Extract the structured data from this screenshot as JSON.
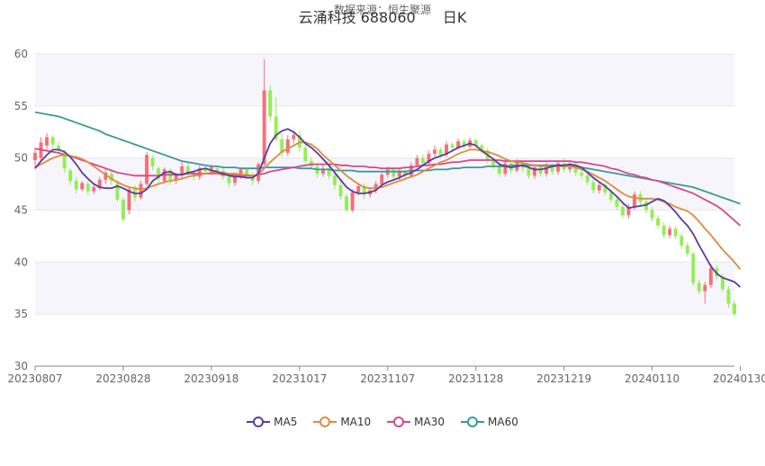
{
  "chart_data": {
    "type": "candlestick",
    "title": "云涌科技 688060",
    "title_suffix": "日K",
    "subtitle": "数据来源：恒生聚源",
    "ylim": [
      30,
      60
    ],
    "yticks": [
      30,
      35,
      40,
      45,
      50,
      55,
      60
    ],
    "xtick_labels": [
      "20230807",
      "20230828",
      "20230918",
      "20231017",
      "20231107",
      "20231128",
      "20231219",
      "20240110",
      "20240130"
    ],
    "xtick_index": [
      0,
      15,
      30,
      45,
      60,
      75,
      90,
      105,
      120
    ],
    "grid": "horizontal",
    "legend_position": "bottom",
    "colors": {
      "up": "#f56f79",
      "down": "#94ee54",
      "band": "#f5f5fb",
      "grid": "#e6e6ee",
      "axis": "#888888"
    },
    "candles": [
      [
        49.8,
        50.5,
        49.0,
        51.0
      ],
      [
        50.0,
        51.5,
        49.6,
        52.0
      ],
      [
        51.2,
        52.0,
        50.6,
        52.4
      ],
      [
        52.0,
        51.3,
        51.0,
        52.2
      ],
      [
        51.2,
        50.8,
        50.4,
        51.6
      ],
      [
        50.6,
        49.0,
        48.6,
        50.8
      ],
      [
        48.8,
        47.8,
        47.4,
        49.0
      ],
      [
        47.8,
        47.0,
        46.6,
        48.2
      ],
      [
        47.0,
        47.6,
        46.8,
        47.8
      ],
      [
        47.5,
        46.8,
        46.4,
        47.8
      ],
      [
        46.8,
        47.2,
        46.5,
        47.4
      ],
      [
        47.1,
        47.9,
        46.9,
        48.2
      ],
      [
        47.9,
        48.6,
        47.5,
        48.9
      ],
      [
        48.5,
        47.8,
        47.4,
        49.0
      ],
      [
        47.6,
        46.0,
        45.8,
        47.8
      ],
      [
        46.0,
        44.1,
        43.9,
        46.2
      ],
      [
        45.0,
        47.0,
        44.6,
        47.3
      ],
      [
        47.0,
        46.2,
        45.8,
        47.4
      ],
      [
        46.2,
        47.5,
        46.0,
        47.8
      ],
      [
        47.5,
        50.3,
        47.3,
        50.6
      ],
      [
        50.0,
        49.2,
        48.8,
        50.3
      ],
      [
        49.0,
        48.0,
        47.6,
        49.2
      ],
      [
        47.8,
        48.9,
        47.5,
        49.1
      ],
      [
        48.8,
        47.9,
        47.4,
        49.0
      ],
      [
        47.9,
        48.4,
        47.5,
        48.6
      ],
      [
        48.4,
        49.2,
        48.0,
        49.6
      ],
      [
        49.2,
        48.6,
        48.3,
        49.5
      ],
      [
        48.6,
        48.2,
        47.9,
        48.8
      ],
      [
        48.2,
        49.0,
        47.9,
        49.3
      ],
      [
        49.0,
        48.7,
        48.4,
        49.3
      ],
      [
        48.7,
        49.1,
        48.4,
        49.4
      ],
      [
        49.0,
        48.8,
        48.5,
        49.2
      ],
      [
        48.8,
        48.2,
        47.9,
        49.0
      ],
      [
        48.2,
        47.6,
        47.2,
        48.4
      ],
      [
        47.6,
        48.3,
        47.3,
        48.5
      ],
      [
        48.3,
        48.9,
        48.0,
        49.1
      ],
      [
        48.9,
        48.4,
        48.1,
        49.0
      ],
      [
        48.4,
        47.8,
        47.4,
        48.6
      ],
      [
        47.8,
        49.4,
        47.5,
        49.6
      ],
      [
        49.4,
        56.5,
        49.2,
        59.5
      ],
      [
        56.5,
        54.0,
        53.5,
        57.0
      ],
      [
        54.0,
        51.8,
        51.6,
        55.8
      ],
      [
        51.8,
        50.5,
        50.1,
        52.4
      ],
      [
        50.5,
        51.8,
        50.2,
        52.2
      ],
      [
        51.8,
        52.2,
        51.4,
        52.6
      ],
      [
        52.2,
        51.0,
        50.6,
        52.6
      ],
      [
        51.0,
        49.7,
        49.4,
        51.4
      ],
      [
        49.7,
        49.2,
        48.9,
        50.1
      ],
      [
        49.2,
        48.5,
        48.1,
        49.5
      ],
      [
        48.5,
        49.0,
        48.2,
        49.4
      ],
      [
        49.0,
        48.3,
        48.0,
        49.3
      ],
      [
        48.3,
        47.4,
        47.0,
        48.5
      ],
      [
        47.4,
        46.3,
        46.0,
        47.8
      ],
      [
        46.3,
        45.0,
        44.8,
        46.5
      ],
      [
        45.0,
        46.7,
        44.8,
        47.0
      ],
      [
        46.7,
        47.3,
        46.4,
        47.6
      ],
      [
        47.3,
        46.5,
        46.1,
        47.6
      ],
      [
        46.5,
        46.9,
        46.2,
        47.1
      ],
      [
        46.9,
        47.5,
        46.6,
        47.8
      ],
      [
        47.5,
        48.4,
        47.2,
        48.6
      ],
      [
        48.4,
        48.9,
        48.1,
        49.2
      ],
      [
        48.9,
        48.2,
        47.9,
        49.1
      ],
      [
        48.2,
        48.8,
        47.9,
        49.1
      ],
      [
        48.8,
        48.3,
        48.0,
        49.0
      ],
      [
        48.3,
        49.3,
        48.1,
        49.6
      ],
      [
        49.3,
        50.0,
        49.1,
        50.3
      ],
      [
        50.0,
        49.5,
        49.2,
        50.3
      ],
      [
        49.5,
        50.4,
        49.3,
        50.7
      ],
      [
        50.4,
        50.8,
        50.1,
        51.2
      ],
      [
        50.8,
        50.3,
        50.0,
        51.0
      ],
      [
        50.3,
        51.3,
        50.1,
        51.6
      ],
      [
        51.3,
        51.0,
        50.7,
        51.5
      ],
      [
        51.0,
        51.6,
        50.8,
        51.9
      ],
      [
        51.6,
        51.1,
        50.8,
        51.8
      ],
      [
        51.1,
        51.7,
        50.9,
        52.0
      ],
      [
        51.7,
        51.2,
        50.9,
        51.9
      ],
      [
        51.2,
        50.7,
        50.4,
        51.4
      ],
      [
        50.7,
        49.8,
        49.5,
        51.0
      ],
      [
        49.8,
        49.3,
        48.9,
        50.0
      ],
      [
        49.3,
        48.5,
        48.2,
        49.6
      ],
      [
        48.5,
        49.5,
        48.2,
        49.8
      ],
      [
        49.5,
        48.8,
        48.5,
        49.7
      ],
      [
        48.8,
        49.6,
        48.6,
        49.9
      ],
      [
        49.6,
        49.0,
        48.7,
        49.8
      ],
      [
        49.0,
        48.3,
        48.0,
        49.3
      ],
      [
        48.3,
        49.1,
        48.0,
        49.4
      ],
      [
        49.1,
        48.5,
        48.2,
        49.3
      ],
      [
        48.5,
        49.3,
        48.2,
        49.6
      ],
      [
        49.3,
        48.7,
        48.4,
        49.5
      ],
      [
        48.7,
        49.5,
        48.4,
        49.8
      ],
      [
        49.5,
        48.9,
        48.6,
        50.0
      ],
      [
        48.9,
        49.4,
        48.6,
        49.7
      ],
      [
        49.4,
        48.6,
        48.3,
        49.6
      ],
      [
        48.6,
        48.3,
        48.0,
        48.8
      ],
      [
        48.3,
        47.7,
        47.4,
        48.5
      ],
      [
        47.7,
        46.9,
        46.6,
        48.0
      ],
      [
        46.9,
        47.4,
        46.6,
        47.7
      ],
      [
        47.4,
        46.7,
        46.4,
        47.6
      ],
      [
        46.7,
        46.0,
        45.7,
        47.0
      ],
      [
        46.0,
        45.3,
        45.0,
        46.3
      ],
      [
        45.3,
        44.5,
        44.2,
        45.6
      ],
      [
        44.5,
        45.3,
        44.2,
        45.6
      ],
      [
        45.3,
        46.5,
        45.0,
        46.8
      ],
      [
        46.5,
        45.8,
        45.4,
        46.8
      ],
      [
        45.8,
        45.0,
        44.7,
        46.1
      ],
      [
        45.0,
        44.2,
        43.9,
        45.3
      ],
      [
        44.2,
        43.5,
        43.2,
        44.5
      ],
      [
        43.5,
        42.6,
        42.3,
        43.8
      ],
      [
        42.6,
        43.2,
        42.3,
        43.5
      ],
      [
        43.2,
        42.5,
        42.2,
        43.5
      ],
      [
        42.5,
        41.6,
        41.3,
        42.8
      ],
      [
        41.6,
        40.8,
        40.5,
        41.9
      ],
      [
        40.8,
        38.0,
        37.7,
        41.0
      ],
      [
        38.0,
        37.2,
        36.9,
        38.3
      ],
      [
        37.2,
        37.8,
        36.0,
        38.1
      ],
      [
        37.8,
        39.4,
        37.5,
        39.8
      ],
      [
        39.4,
        38.6,
        38.3,
        39.7
      ],
      [
        38.6,
        37.4,
        37.1,
        38.9
      ],
      [
        37.4,
        36.0,
        35.6,
        37.7
      ],
      [
        36.0,
        35.0,
        34.8,
        36.3
      ]
    ],
    "series": [
      {
        "name": "MA5",
        "color": "#5a3d9c",
        "values": [
          49.0,
          49.7,
          50.3,
          50.8,
          50.8,
          50.6,
          50.1,
          49.4,
          48.6,
          48.0,
          47.5,
          47.2,
          47.1,
          47.1,
          47.3,
          47.1,
          46.8,
          46.6,
          46.6,
          47.0,
          47.8,
          48.2,
          48.6,
          48.7,
          48.4,
          48.4,
          48.6,
          48.7,
          48.9,
          49.0,
          48.8,
          48.7,
          48.5,
          48.3,
          48.2,
          48.2,
          48.1,
          48.1,
          48.5,
          50.0,
          51.4,
          52.2,
          52.6,
          52.8,
          52.5,
          52.0,
          51.4,
          51.0,
          50.5,
          49.9,
          49.3,
          48.6,
          47.9,
          47.2,
          46.8,
          46.6,
          46.6,
          46.7,
          46.9,
          47.4,
          47.7,
          47.9,
          48.1,
          48.4,
          48.6,
          48.9,
          49.3,
          49.7,
          50.0,
          50.2,
          50.4,
          50.7,
          51.0,
          51.2,
          51.4,
          51.2,
          50.7,
          50.3,
          49.9,
          49.4,
          49.2,
          49.1,
          49.2,
          49.3,
          49.1,
          48.9,
          48.9,
          49.0,
          49.2,
          49.3,
          49.3,
          49.4,
          49.3,
          49.1,
          48.6,
          48.1,
          47.7,
          47.3,
          46.8,
          46.3,
          45.7,
          45.2,
          45.3,
          45.4,
          45.5,
          45.8,
          46.1,
          45.9,
          45.4,
          44.8,
          44.1,
          43.5,
          42.7,
          41.6,
          40.6,
          39.6,
          38.9,
          38.5,
          38.3,
          38.1,
          37.6
        ]
      },
      {
        "name": "MA10",
        "color": "#e08a3c",
        "values": [
          49.1,
          49.4,
          49.7,
          50.0,
          50.2,
          50.3,
          50.2,
          50.1,
          49.9,
          49.6,
          49.2,
          48.8,
          48.4,
          48.0,
          47.7,
          47.4,
          47.2,
          47.1,
          47.0,
          47.1,
          47.3,
          47.5,
          47.7,
          47.8,
          47.9,
          48.0,
          48.2,
          48.3,
          48.4,
          48.5,
          48.6,
          48.6,
          48.6,
          48.5,
          48.5,
          48.4,
          48.4,
          48.3,
          48.4,
          49.0,
          49.6,
          50.1,
          50.6,
          50.9,
          51.2,
          51.5,
          51.5,
          51.3,
          50.9,
          50.3,
          49.8,
          49.3,
          48.8,
          48.3,
          47.9,
          47.5,
          47.2,
          47.1,
          47.1,
          47.2,
          47.4,
          47.6,
          47.8,
          48.0,
          48.2,
          48.4,
          48.7,
          49.0,
          49.3,
          49.6,
          49.8,
          50.1,
          50.4,
          50.6,
          50.8,
          50.8,
          50.7,
          50.6,
          50.4,
          50.2,
          49.9,
          49.7,
          49.6,
          49.5,
          49.4,
          49.3,
          49.2,
          49.2,
          49.2,
          49.2,
          49.2,
          49.2,
          49.1,
          48.9,
          48.7,
          48.4,
          48.1,
          47.8,
          47.4,
          47.0,
          46.6,
          46.3,
          46.2,
          46.1,
          46.1,
          46.1,
          46.0,
          45.8,
          45.6,
          45.3,
          45.1,
          44.9,
          44.5,
          43.9,
          43.2,
          42.6,
          41.9,
          41.2,
          40.6,
          40.0,
          39.3
        ]
      },
      {
        "name": "MA30",
        "color": "#d6488f",
        "values": [
          50.9,
          50.8,
          50.7,
          50.6,
          50.5,
          50.3,
          50.2,
          50.0,
          49.8,
          49.6,
          49.4,
          49.2,
          49.0,
          48.8,
          48.6,
          48.5,
          48.4,
          48.3,
          48.3,
          48.3,
          48.3,
          48.3,
          48.4,
          48.4,
          48.4,
          48.4,
          48.5,
          48.5,
          48.5,
          48.5,
          48.5,
          48.5,
          48.4,
          48.4,
          48.4,
          48.3,
          48.3,
          48.3,
          48.4,
          48.5,
          48.7,
          48.8,
          48.9,
          49.0,
          49.1,
          49.2,
          49.3,
          49.4,
          49.4,
          49.4,
          49.4,
          49.4,
          49.3,
          49.3,
          49.2,
          49.2,
          49.2,
          49.1,
          49.1,
          49.0,
          49.0,
          49.0,
          49.0,
          49.1,
          49.1,
          49.2,
          49.3,
          49.3,
          49.4,
          49.4,
          49.5,
          49.6,
          49.6,
          49.7,
          49.8,
          49.8,
          49.8,
          49.8,
          49.8,
          49.8,
          49.7,
          49.7,
          49.7,
          49.7,
          49.7,
          49.7,
          49.7,
          49.7,
          49.7,
          49.7,
          49.7,
          49.7,
          49.6,
          49.6,
          49.5,
          49.4,
          49.3,
          49.2,
          49.0,
          48.9,
          48.7,
          48.5,
          48.4,
          48.2,
          48.1,
          47.9,
          47.8,
          47.6,
          47.4,
          47.2,
          47.0,
          46.8,
          46.6,
          46.3,
          46.0,
          45.7,
          45.4,
          45.0,
          44.5,
          44.0,
          43.5
        ]
      },
      {
        "name": "MA60",
        "color": "#3a9a9a",
        "values": [
          54.4,
          54.3,
          54.2,
          54.1,
          54.0,
          53.8,
          53.6,
          53.4,
          53.2,
          53.0,
          52.8,
          52.6,
          52.3,
          52.1,
          51.9,
          51.7,
          51.5,
          51.3,
          51.1,
          50.9,
          50.7,
          50.5,
          50.3,
          50.1,
          49.9,
          49.7,
          49.6,
          49.5,
          49.4,
          49.3,
          49.2,
          49.2,
          49.1,
          49.1,
          49.1,
          49.0,
          49.0,
          49.0,
          49.0,
          49.1,
          49.1,
          49.1,
          49.1,
          49.1,
          49.1,
          49.0,
          49.0,
          49.0,
          48.9,
          48.9,
          48.9,
          48.8,
          48.8,
          48.8,
          48.8,
          48.7,
          48.7,
          48.7,
          48.7,
          48.7,
          48.7,
          48.7,
          48.7,
          48.7,
          48.8,
          48.8,
          48.8,
          48.8,
          48.9,
          48.9,
          48.9,
          49.0,
          49.0,
          49.1,
          49.1,
          49.1,
          49.1,
          49.2,
          49.2,
          49.2,
          49.2,
          49.3,
          49.3,
          49.3,
          49.3,
          49.3,
          49.3,
          49.3,
          49.3,
          49.3,
          49.3,
          49.3,
          49.2,
          49.1,
          49.0,
          48.9,
          48.8,
          48.7,
          48.6,
          48.5,
          48.4,
          48.3,
          48.2,
          48.1,
          48.0,
          47.9,
          47.8,
          47.7,
          47.6,
          47.5,
          47.4,
          47.3,
          47.2,
          47.0,
          46.8,
          46.6,
          46.4,
          46.2,
          46.0,
          45.8,
          45.6
        ]
      }
    ]
  }
}
